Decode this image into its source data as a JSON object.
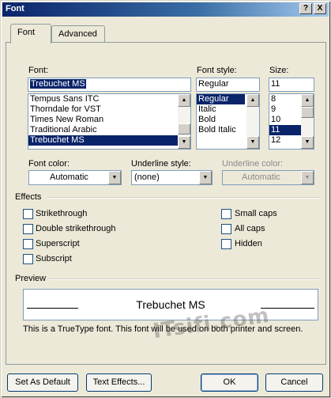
{
  "window": {
    "title": "Font",
    "help_button": "?",
    "close_button": "X"
  },
  "tabs": [
    {
      "label": "Font",
      "active": true
    },
    {
      "label": "Advanced",
      "active": false
    }
  ],
  "font": {
    "label": "Font:",
    "value": "Trebuchet MS",
    "list": [
      "Tempus Sans ITC",
      "Thorndale for VST",
      "Times New Roman",
      "Traditional Arabic",
      "Trebuchet MS"
    ],
    "selected_index": 4
  },
  "font_style": {
    "label": "Font style:",
    "value": "Regular",
    "list": [
      "Regular",
      "Italic",
      "Bold",
      "Bold Italic"
    ],
    "selected_index": 0
  },
  "size": {
    "label": "Size:",
    "value": "11",
    "list": [
      "8",
      "9",
      "10",
      "11",
      "12"
    ],
    "selected_index": 3
  },
  "font_color": {
    "label": "Font color:",
    "value": "Automatic"
  },
  "underline_style": {
    "label": "Underline style:",
    "value": "(none)"
  },
  "underline_color": {
    "label": "Underline color:",
    "value": "Automatic",
    "disabled": true
  },
  "effects": {
    "label": "Effects",
    "left": [
      {
        "label": "Strikethrough",
        "checked": false
      },
      {
        "label": "Double strikethrough",
        "checked": false
      },
      {
        "label": "Superscript",
        "checked": false
      },
      {
        "label": "Subscript",
        "checked": false
      }
    ],
    "right": [
      {
        "label": "Small caps",
        "checked": false
      },
      {
        "label": "All caps",
        "checked": false
      },
      {
        "label": "Hidden",
        "checked": false
      }
    ]
  },
  "preview": {
    "label": "Preview",
    "sample": "Trebuchet MS",
    "note": "This is a TrueType font. This font will be used on both printer and screen."
  },
  "watermark": "ITsifi.com",
  "buttons": {
    "set_as_default": "Set As Default",
    "text_effects": "Text Effects...",
    "ok": "OK",
    "cancel": "Cancel"
  },
  "colors": {
    "title_bar": "#0a246a",
    "selection": "#0a246a",
    "dialog_bg": "#ece9d8",
    "field_border": "#7f9db9"
  }
}
